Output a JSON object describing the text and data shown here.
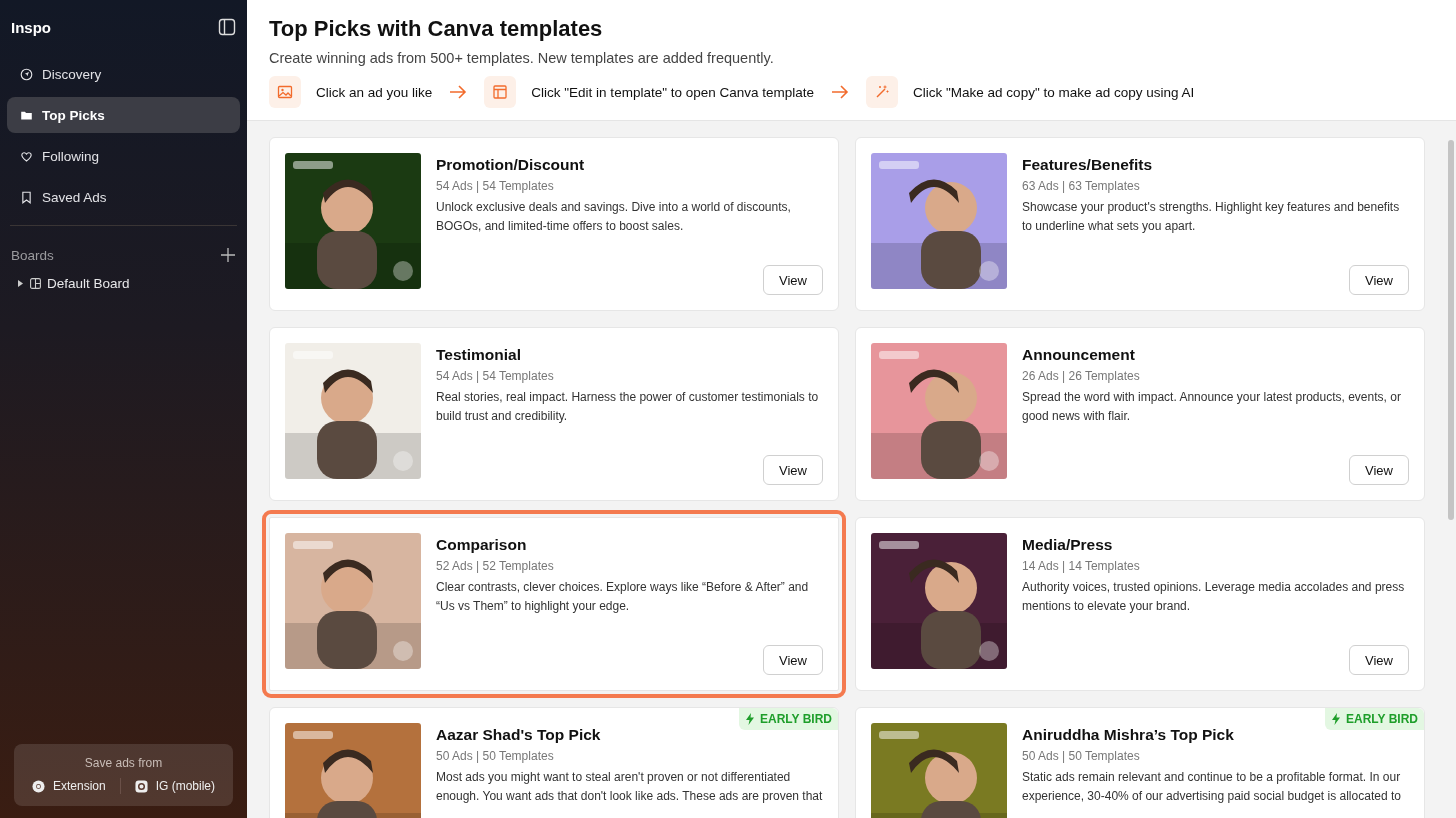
{
  "sidebar": {
    "logo": "Inspo",
    "nav": [
      {
        "label": "Discovery",
        "selected": false
      },
      {
        "label": "Top Picks",
        "selected": true
      },
      {
        "label": "Following",
        "selected": false
      },
      {
        "label": "Saved Ads",
        "selected": false
      }
    ],
    "boards_label": "Boards",
    "boards": [
      {
        "label": "Default Board",
        "expanded": false
      }
    ],
    "save_box": {
      "title": "Save ads from",
      "sources": [
        {
          "label": "Extension"
        },
        {
          "label": "IG (mobile)"
        }
      ]
    }
  },
  "header": {
    "title": "Top Picks with Canva templates",
    "subtitle": "Create winning ads from 500+ templates. New templates are added frequently.",
    "steps": [
      {
        "label": "Click an ad you like"
      },
      {
        "label": "Click \"Edit in template\" to open Canva template"
      },
      {
        "label": "Click \"Make ad copy\" to make ad copy using AI"
      }
    ]
  },
  "cards": [
    {
      "title": "Promotion/Discount",
      "meta": "54 Ads | 54 Templates",
      "description": "Unlock exclusive deals and savings. Dive into a world of discounts, BOGOs, and limited-time offers to boost sales.",
      "button": "View",
      "highlighted": false
    },
    {
      "title": "Features/Benefits",
      "meta": "63 Ads | 63 Templates",
      "description": "Showcase your product's strengths. Highlight key features and benefits to underline what sets you apart.",
      "button": "View",
      "highlighted": false
    },
    {
      "title": "Testimonial",
      "meta": "54 Ads | 54 Templates",
      "description": "Real stories, real impact. Harness the power of customer testimonials to build trust and credibility.",
      "button": "View",
      "highlighted": false
    },
    {
      "title": "Announcement",
      "meta": "26 Ads | 26 Templates",
      "description": "Spread the word with impact. Announce your latest products, events, or good news with flair.",
      "button": "View",
      "highlighted": false
    },
    {
      "title": "Comparison",
      "meta": "52 Ads | 52 Templates",
      "description": "Clear contrasts, clever choices. Explore ways like “Before & After” and “Us vs Them” to highlight your edge.",
      "button": "View",
      "highlighted": true
    },
    {
      "title": "Media/Press",
      "meta": "14 Ads | 14 Templates",
      "description": "Authority voices, trusted opinions. Leverage media accolades and press mentions to elevate your brand.",
      "button": "View",
      "highlighted": false
    },
    {
      "title": "Aazar Shad's Top Pick",
      "meta": "50 Ads | 50 Templates",
      "description": "Most ads you might want to steal aren't proven or not differentiated enough. You want ads that don't look like ads. These ads are proven that",
      "badge": "EARLY BIRD",
      "highlighted": false
    },
    {
      "title": "Aniruddha Mishra’s Top Pick",
      "meta": "50 Ads | 50 Templates",
      "description": "Static ads remain relevant and continue to be a profitable format. In our experience, 30-40% of our advertising paid social budget is allocated to",
      "badge": "EARLY BIRD",
      "highlighted": false
    }
  ]
}
